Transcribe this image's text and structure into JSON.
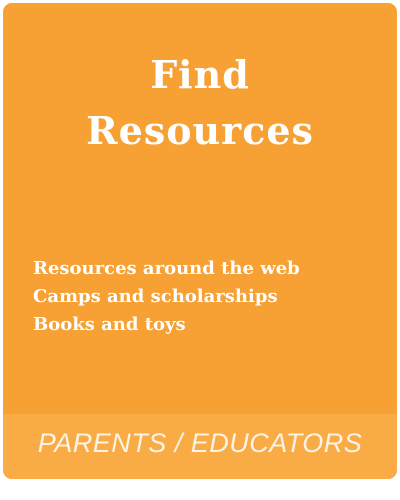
{
  "card": {
    "title_line1": "Find",
    "title_line2": "Resources",
    "links": [
      "Resources around the web",
      "Camps and scholarships",
      "Books and toys"
    ],
    "footer_label": "PARENTS / EDUCATORS"
  },
  "colors": {
    "card_background": "#f7a034",
    "footer_background": "#f9ab45",
    "text": "#ffffff"
  }
}
